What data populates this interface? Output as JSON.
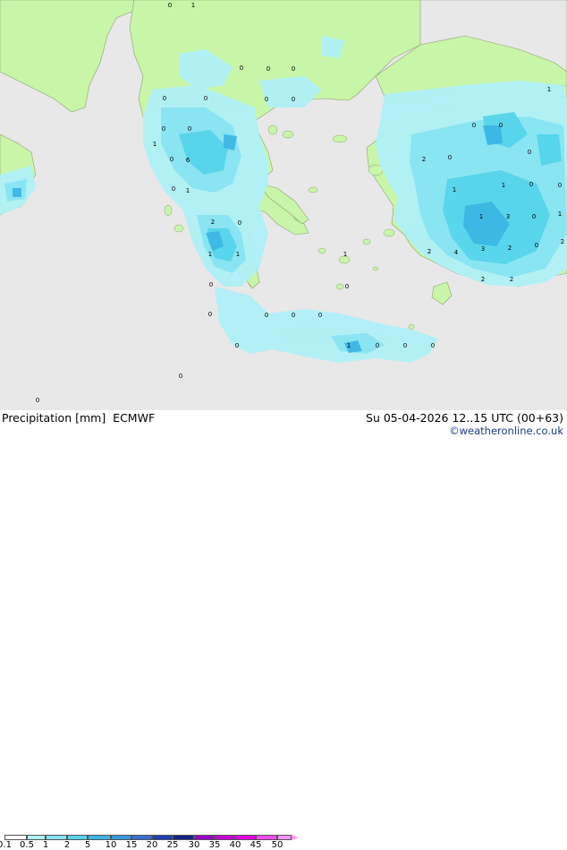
{
  "title": "Precipitation [mm]",
  "model": "ECMWF",
  "timestamp": "Su 05-04-2026 12..15 UTC (00+63)",
  "credit": "©weatheronline.co.uk",
  "legend": {
    "ticks": [
      "0.1",
      "0.5",
      "1",
      "2",
      "5",
      "10",
      "15",
      "20",
      "25",
      "30",
      "35",
      "40",
      "45",
      "50"
    ],
    "colors": [
      "#ffffff",
      "#b0f0f7",
      "#88e4f2",
      "#56d5ea",
      "#3cb7e4",
      "#3a97dd",
      "#3a6fd0",
      "#1f3fae",
      "#14248c",
      "#9b00c8",
      "#c800d8",
      "#e600e6",
      "#f04cf0",
      "#f894f8"
    ]
  },
  "map_labels": [
    "1",
    "0",
    "0",
    "0",
    "0",
    "0",
    "0",
    "0",
    "0",
    "0",
    "0",
    "1",
    "6",
    "0",
    "1",
    "0",
    "2",
    "0",
    "1",
    "1",
    "0",
    "0",
    "0",
    "0",
    "0",
    "0",
    "0",
    "0",
    "1",
    "0",
    "0",
    "0",
    "2",
    "0",
    "0",
    "1",
    "1",
    "0",
    "1",
    "0",
    "1",
    "3",
    "0",
    "1",
    "4",
    "3",
    "0",
    "2",
    "2",
    "2",
    "2",
    "2",
    "0",
    "0",
    "1",
    "0"
  ]
}
